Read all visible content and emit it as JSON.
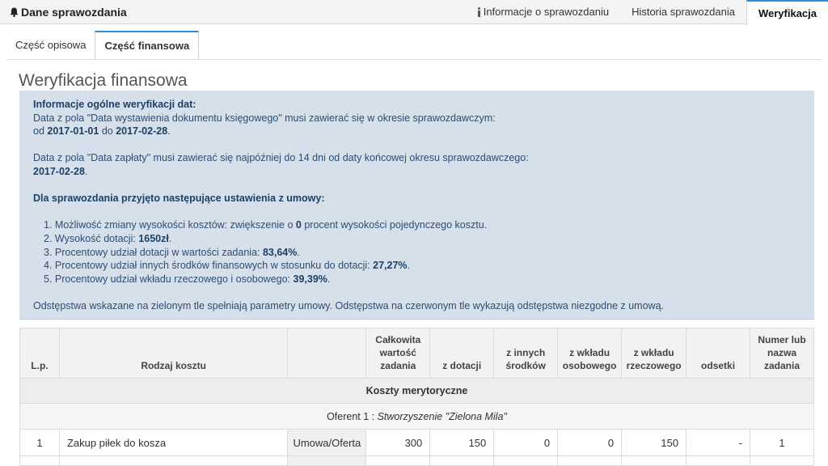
{
  "header": {
    "title": "Dane sprawozdania",
    "tabs": [
      {
        "label": "Informacje o sprawozdaniu"
      },
      {
        "label": "Historia sprawozdania"
      },
      {
        "label": "Weryfikacja"
      }
    ]
  },
  "subtabs": [
    {
      "label": "Część opisowa"
    },
    {
      "label": "Część finansowa"
    }
  ],
  "page_title": "Weryfikacja finansowa",
  "info": {
    "heading1": "Informacje ogólne weryfikacji dat:",
    "line1": "Data z pola \"Data wystawienia dokumentu księgowego\" musi zawierać się w okresie sprawozdawczym:",
    "od_label": "od ",
    "date_from": "2017-01-01",
    "do_label": " do ",
    "date_to": "2017-02-28",
    "period_end": ".",
    "line2": "Data z pola \"Data zapłaty\" musi zawierać się najpóźniej do 14 dni od daty końcowej okresu sprawozdawczego:",
    "date_pay": "2017-02-28",
    "dot": ".",
    "heading2": "Dla sprawozdania przyjęto następujące ustawienia z umowy:",
    "items": [
      {
        "pre": "1. Możliwość zmiany wysokości kosztów: zwiększenie o ",
        "val": "0",
        "post": " procent wysokości pojedynczego kosztu."
      },
      {
        "pre": "2. Wysokość dotacji: ",
        "val": "1650zł",
        "post": "."
      },
      {
        "pre": "3. Procentowy udział dotacji w wartości zadania: ",
        "val": "83,64%",
        "post": "."
      },
      {
        "pre": "4. Procentowy udział innych środków finansowych w stosunku do dotacji: ",
        "val": "27,27%",
        "post": "."
      },
      {
        "pre": "5. Procentowy udział wkładu rzeczowego i osobowego: ",
        "val": "39,39%",
        "post": "."
      }
    ],
    "footer": "Odstępstwa wskazane na zielonym tle spełniają parametry umowy. Odstępstwa na czerwonym tle wykazują odstępstwa niezgodne z umową."
  },
  "table": {
    "columns": [
      "L.p.",
      "Rodzaj kosztu",
      "",
      "Całkowita wartość zadania",
      "z dotacji",
      "z innych środków",
      "z wkładu osobowego",
      "z wkładu rzeczowego",
      "odsetki",
      "Numer lub nazwa zadania"
    ],
    "section": "Koszty merytoryczne",
    "oferent_label": "Oferent 1 : ",
    "oferent_name": "Stworzyszenie \"Zielona Mila\"",
    "rows": [
      {
        "lp": "1",
        "rodzaj": "Zakup piłek do kosza",
        "typ": "Umowa/Oferta",
        "calkowita": "300",
        "dotacja": "150",
        "inne": "0",
        "osobowy": "0",
        "rzeczowy": "150",
        "odsetki": "-",
        "numer": "1"
      }
    ]
  }
}
